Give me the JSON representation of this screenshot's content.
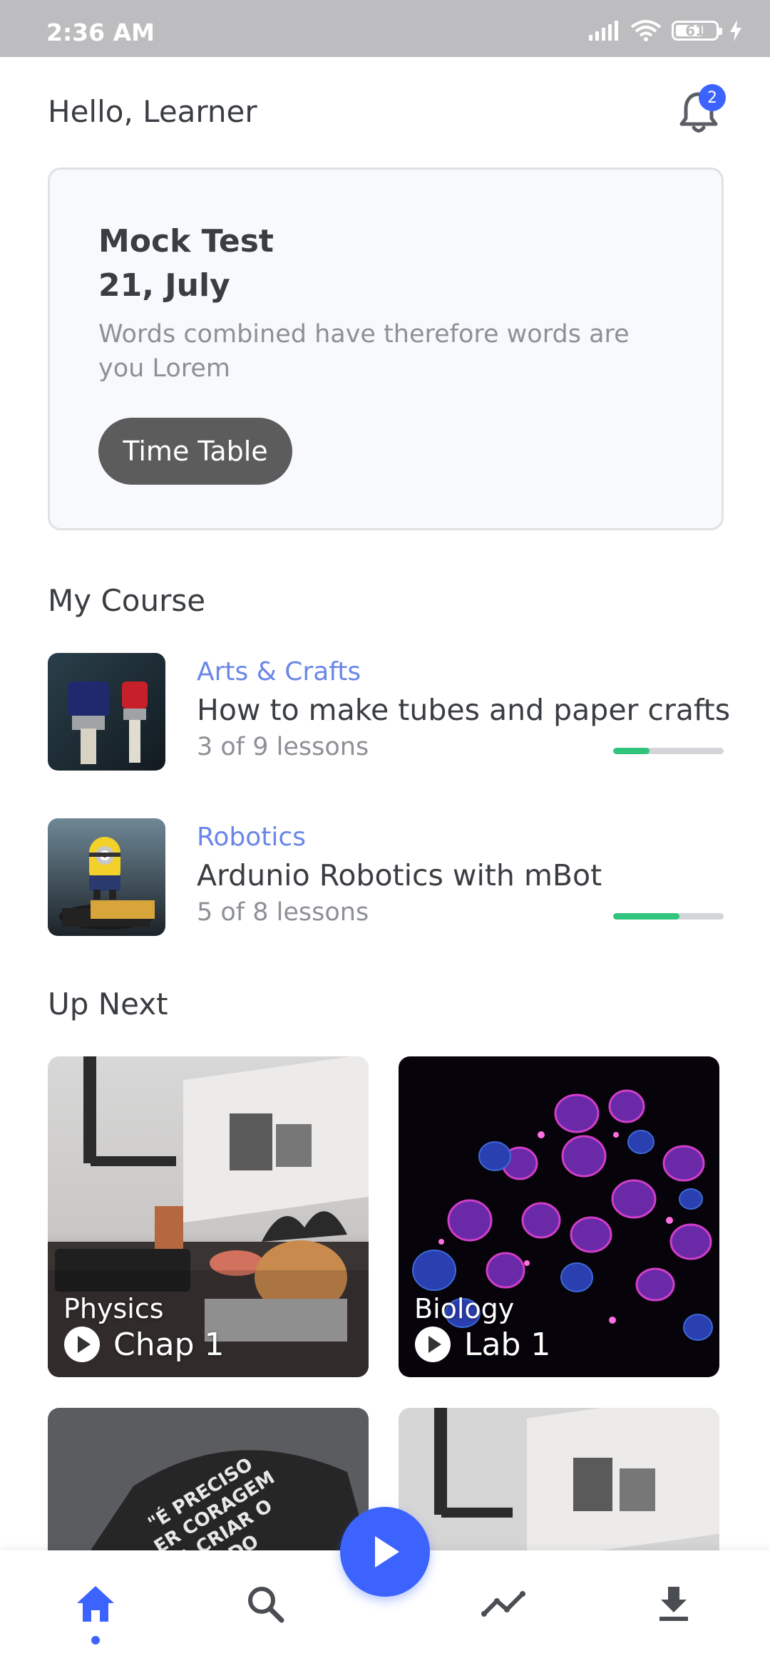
{
  "status_bar": {
    "time": "2:36 AM",
    "battery": "61"
  },
  "header": {
    "greeting": "Hello, Learner",
    "notification_count": "2"
  },
  "mock_test": {
    "title_line1": "Mock Test",
    "title_line2": "21, July",
    "description": "Words combined have therefore words are you Lorem",
    "button_label": "Time Table"
  },
  "my_course": {
    "title": "My Course",
    "courses": [
      {
        "category": "Arts & Crafts",
        "name": "How to make tubes and paper crafts",
        "lessons": "3 of 9 lessons",
        "progress": 0.33
      },
      {
        "category": "Robotics",
        "name": "Ardunio Robotics with mBot",
        "lessons": "5 of 8 lessons",
        "progress": 0.6
      }
    ]
  },
  "up_next": {
    "title": "Up Next",
    "tiles": [
      {
        "subject": "Physics",
        "chapter": "Chap 1"
      },
      {
        "subject": "Biology",
        "chapter": "Lab 1"
      }
    ]
  },
  "colors": {
    "accent": "#3d63ff",
    "progress": "#31c47c",
    "category": "#6a86e8"
  },
  "nav": [
    "home-icon",
    "search-icon",
    "play-icon",
    "trend-icon",
    "download-icon"
  ]
}
